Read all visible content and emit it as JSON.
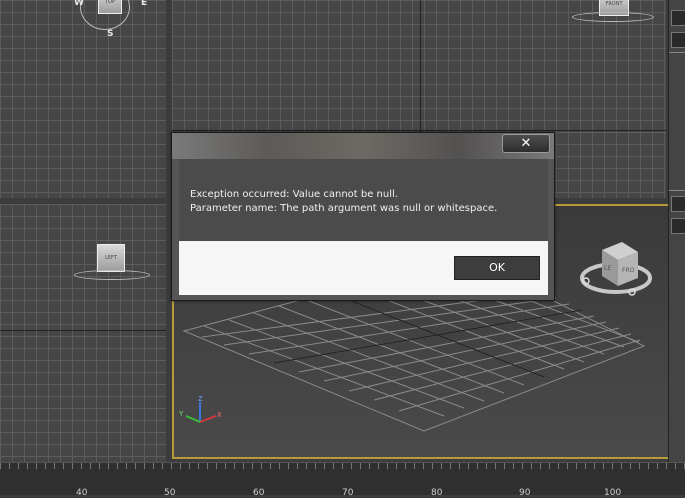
{
  "viewports": {
    "top": {
      "cube_label": "TOP",
      "compass": {
        "west": "W",
        "east": "E",
        "south": "S"
      }
    },
    "front": {
      "cube_label": "FRONT"
    },
    "left": {
      "cube_label": "LEFT"
    },
    "perspective": {
      "cube_labels": [
        "LE",
        "FRO"
      ],
      "gizmo": {
        "x": "X",
        "y": "Y",
        "z": "Z"
      },
      "highlight_color": "#b79b3a"
    }
  },
  "timeline": {
    "ticks": [
      "40",
      "50",
      "60",
      "70",
      "80",
      "90",
      "100"
    ]
  },
  "dialog": {
    "close_label": "✕",
    "message_line1": "Exception occurred: Value cannot be null.",
    "message_line2": "Parameter name: The path argument was null or whitespace.",
    "ok_label": "OK"
  },
  "icons": {
    "close": "close-icon"
  }
}
